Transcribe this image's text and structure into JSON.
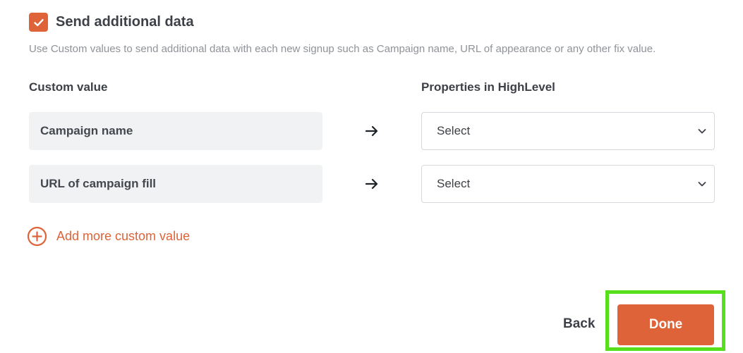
{
  "send_additional": {
    "checked": true,
    "label": "Send additional data",
    "description": "Use Custom values to send additional data with each new signup such as Campaign name, URL of appearance or any other fix value."
  },
  "columns": {
    "custom_value_header": "Custom value",
    "properties_header": "Properties in HighLevel"
  },
  "mappings": [
    {
      "custom_value": "Campaign name",
      "property": "Select"
    },
    {
      "custom_value": "URL of campaign fill",
      "property": "Select"
    }
  ],
  "add_more": {
    "label": "Add more custom value"
  },
  "footer": {
    "back_label": "Back",
    "done_label": "Done"
  },
  "colors": {
    "accent": "#de6339",
    "highlight": "#56e01c",
    "text": "#3d4147",
    "muted": "#8f9399",
    "field_bg": "#f1f2f4"
  },
  "icons": {
    "checkbox": "check-icon",
    "arrow": "arrow-right-icon",
    "select": "chevron-down-icon",
    "add": "plus-circle-icon"
  }
}
